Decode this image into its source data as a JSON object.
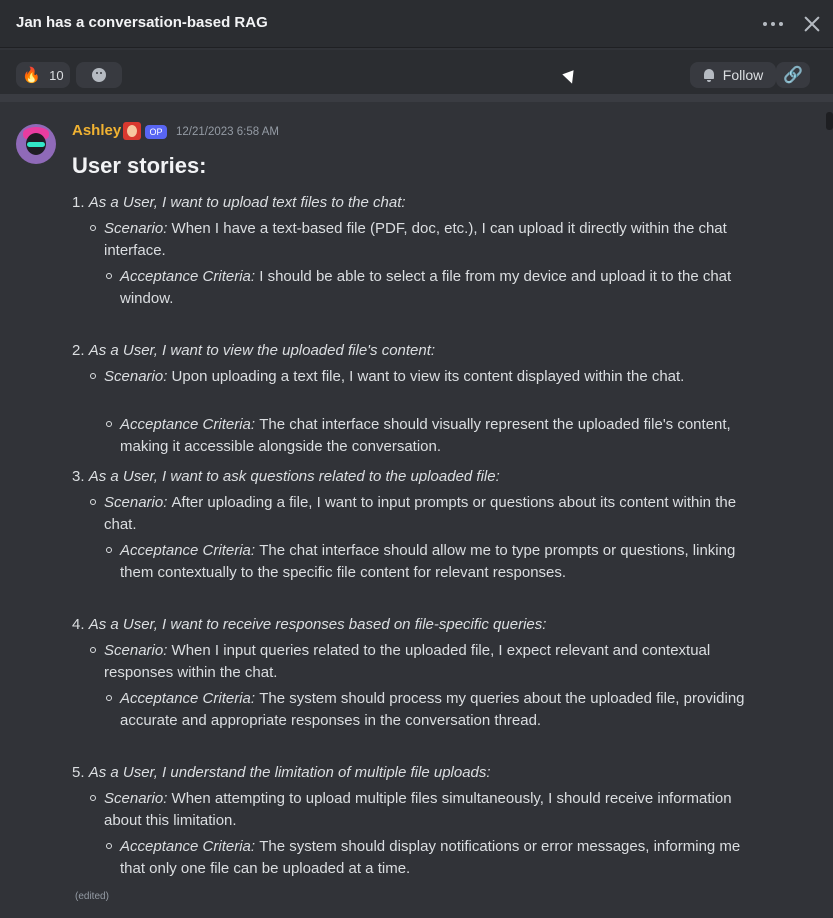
{
  "window": {
    "title": "Jan has a conversation-based RAG"
  },
  "toolbar": {
    "reaction_emoji": "🔥",
    "reaction_count": "10",
    "follow_label": "Follow"
  },
  "message": {
    "author": "Ashley",
    "badge": "OP",
    "timestamp": "12/21/2023 6:58 AM",
    "heading": "User stories:",
    "edited": "(edited)",
    "stories": [
      {
        "number": "1.",
        "title": "As a User, I want to upload text files to the chat:",
        "scenario_label": "Scenario:",
        "scenario_lines": [
          "When I have a text-based file (PDF, doc, etc.), I can upload it directly within the chat",
          "interface."
        ],
        "criteria_label": "Acceptance Criteria:",
        "criteria_lines": [
          "I should be able to select a file from my device and upload it to the chat",
          "window."
        ]
      },
      {
        "number": "2.",
        "title": "As a User, I want to view the uploaded file's content:",
        "scenario_label": "Scenario:",
        "scenario_lines": [
          "Upon uploading a text file, I want to view its content displayed within the chat.",
          ""
        ],
        "criteria_label": "Acceptance Criteria:",
        "criteria_lines": [
          "The chat interface should visually represent the uploaded file's content,",
          "making it accessible alongside the conversation."
        ]
      },
      {
        "number": "3.",
        "title": "As a User, I want to ask questions related to the uploaded file:",
        "scenario_label": "Scenario:",
        "scenario_lines": [
          "After uploading a file, I want to input prompts or questions about its content within the",
          "chat."
        ],
        "criteria_label": "Acceptance Criteria:",
        "criteria_lines": [
          "The chat interface should allow me to type prompts or questions, linking",
          "them contextually to the specific file content for relevant responses."
        ]
      },
      {
        "number": "4.",
        "title": "As a User, I want to receive responses based on file-specific queries:",
        "scenario_label": "Scenario:",
        "scenario_lines": [
          "When I input queries related to the uploaded file, I expect relevant and contextual",
          "responses within the chat."
        ],
        "criteria_label": "Acceptance Criteria:",
        "criteria_lines": [
          "The system should process my queries about the uploaded file, providing",
          "accurate and appropriate responses in the conversation thread."
        ]
      },
      {
        "number": "5.",
        "title": "As a User, I understand the limitation of multiple file uploads:",
        "scenario_label": "Scenario:",
        "scenario_lines": [
          "When attempting to upload multiple files simultaneously, I should receive information",
          "about this limitation."
        ],
        "criteria_label": "Acceptance Criteria:",
        "criteria_lines": [
          "The system should display notifications or error messages, informing me",
          "that only one file can be uploaded at a time."
        ]
      }
    ]
  }
}
